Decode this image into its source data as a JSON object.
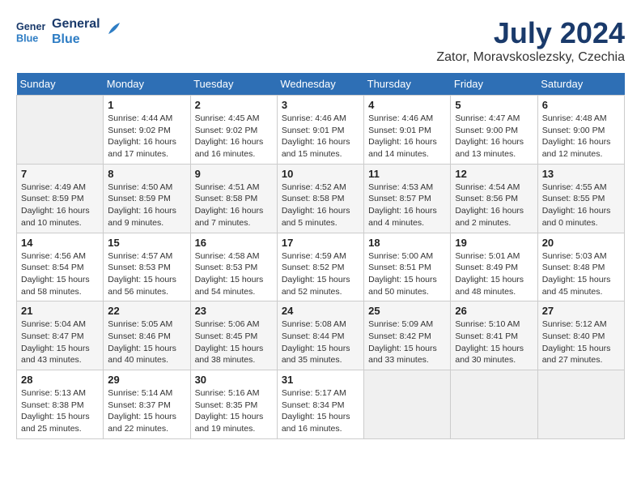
{
  "header": {
    "logo_line1": "General",
    "logo_line2": "Blue",
    "month": "July 2024",
    "location": "Zator, Moravskoslezsky, Czechia"
  },
  "weekdays": [
    "Sunday",
    "Monday",
    "Tuesday",
    "Wednesday",
    "Thursday",
    "Friday",
    "Saturday"
  ],
  "weeks": [
    [
      {
        "day": "",
        "empty": true
      },
      {
        "day": "1",
        "sunrise": "4:44 AM",
        "sunset": "9:02 PM",
        "daylight": "16 hours and 17 minutes."
      },
      {
        "day": "2",
        "sunrise": "4:45 AM",
        "sunset": "9:02 PM",
        "daylight": "16 hours and 16 minutes."
      },
      {
        "day": "3",
        "sunrise": "4:46 AM",
        "sunset": "9:01 PM",
        "daylight": "16 hours and 15 minutes."
      },
      {
        "day": "4",
        "sunrise": "4:46 AM",
        "sunset": "9:01 PM",
        "daylight": "16 hours and 14 minutes."
      },
      {
        "day": "5",
        "sunrise": "4:47 AM",
        "sunset": "9:00 PM",
        "daylight": "16 hours and 13 minutes."
      },
      {
        "day": "6",
        "sunrise": "4:48 AM",
        "sunset": "9:00 PM",
        "daylight": "16 hours and 12 minutes."
      }
    ],
    [
      {
        "day": "7",
        "sunrise": "4:49 AM",
        "sunset": "8:59 PM",
        "daylight": "16 hours and 10 minutes."
      },
      {
        "day": "8",
        "sunrise": "4:50 AM",
        "sunset": "8:59 PM",
        "daylight": "16 hours and 9 minutes."
      },
      {
        "day": "9",
        "sunrise": "4:51 AM",
        "sunset": "8:58 PM",
        "daylight": "16 hours and 7 minutes."
      },
      {
        "day": "10",
        "sunrise": "4:52 AM",
        "sunset": "8:58 PM",
        "daylight": "16 hours and 5 minutes."
      },
      {
        "day": "11",
        "sunrise": "4:53 AM",
        "sunset": "8:57 PM",
        "daylight": "16 hours and 4 minutes."
      },
      {
        "day": "12",
        "sunrise": "4:54 AM",
        "sunset": "8:56 PM",
        "daylight": "16 hours and 2 minutes."
      },
      {
        "day": "13",
        "sunrise": "4:55 AM",
        "sunset": "8:55 PM",
        "daylight": "16 hours and 0 minutes."
      }
    ],
    [
      {
        "day": "14",
        "sunrise": "4:56 AM",
        "sunset": "8:54 PM",
        "daylight": "15 hours and 58 minutes."
      },
      {
        "day": "15",
        "sunrise": "4:57 AM",
        "sunset": "8:53 PM",
        "daylight": "15 hours and 56 minutes."
      },
      {
        "day": "16",
        "sunrise": "4:58 AM",
        "sunset": "8:53 PM",
        "daylight": "15 hours and 54 minutes."
      },
      {
        "day": "17",
        "sunrise": "4:59 AM",
        "sunset": "8:52 PM",
        "daylight": "15 hours and 52 minutes."
      },
      {
        "day": "18",
        "sunrise": "5:00 AM",
        "sunset": "8:51 PM",
        "daylight": "15 hours and 50 minutes."
      },
      {
        "day": "19",
        "sunrise": "5:01 AM",
        "sunset": "8:49 PM",
        "daylight": "15 hours and 48 minutes."
      },
      {
        "day": "20",
        "sunrise": "5:03 AM",
        "sunset": "8:48 PM",
        "daylight": "15 hours and 45 minutes."
      }
    ],
    [
      {
        "day": "21",
        "sunrise": "5:04 AM",
        "sunset": "8:47 PM",
        "daylight": "15 hours and 43 minutes."
      },
      {
        "day": "22",
        "sunrise": "5:05 AM",
        "sunset": "8:46 PM",
        "daylight": "15 hours and 40 minutes."
      },
      {
        "day": "23",
        "sunrise": "5:06 AM",
        "sunset": "8:45 PM",
        "daylight": "15 hours and 38 minutes."
      },
      {
        "day": "24",
        "sunrise": "5:08 AM",
        "sunset": "8:44 PM",
        "daylight": "15 hours and 35 minutes."
      },
      {
        "day": "25",
        "sunrise": "5:09 AM",
        "sunset": "8:42 PM",
        "daylight": "15 hours and 33 minutes."
      },
      {
        "day": "26",
        "sunrise": "5:10 AM",
        "sunset": "8:41 PM",
        "daylight": "15 hours and 30 minutes."
      },
      {
        "day": "27",
        "sunrise": "5:12 AM",
        "sunset": "8:40 PM",
        "daylight": "15 hours and 27 minutes."
      }
    ],
    [
      {
        "day": "28",
        "sunrise": "5:13 AM",
        "sunset": "8:38 PM",
        "daylight": "15 hours and 25 minutes."
      },
      {
        "day": "29",
        "sunrise": "5:14 AM",
        "sunset": "8:37 PM",
        "daylight": "15 hours and 22 minutes."
      },
      {
        "day": "30",
        "sunrise": "5:16 AM",
        "sunset": "8:35 PM",
        "daylight": "15 hours and 19 minutes."
      },
      {
        "day": "31",
        "sunrise": "5:17 AM",
        "sunset": "8:34 PM",
        "daylight": "15 hours and 16 minutes."
      },
      {
        "day": "",
        "empty": true
      },
      {
        "day": "",
        "empty": true
      },
      {
        "day": "",
        "empty": true
      }
    ]
  ],
  "labels": {
    "sunrise_prefix": "Sunrise: ",
    "sunset_prefix": "Sunset: ",
    "daylight_prefix": "Daylight: "
  }
}
